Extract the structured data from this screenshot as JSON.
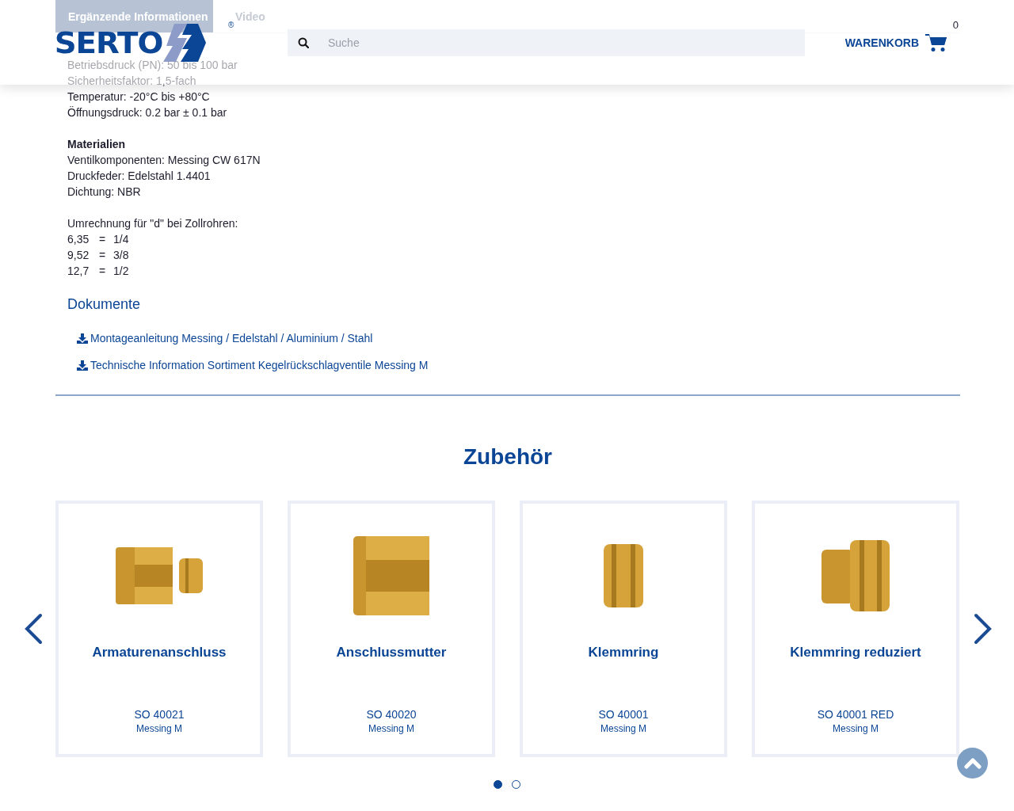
{
  "tabs": [
    {
      "label": "Ergänzende Informationen",
      "selected": true
    },
    {
      "label": "Video",
      "selected": false
    }
  ],
  "header": {
    "logo": "SERTO",
    "registered": "®",
    "search": {
      "placeholder": "Suche"
    },
    "cart": {
      "label": "WARENKORB",
      "count": "0"
    }
  },
  "specs": {
    "lines": [
      "Betriebsdruck (PN): 50 bis 100 bar",
      "Sicherheitsfaktor: 1,5-fach",
      "Temperatur: -20°C bis +80°C",
      "Öffnungsdruck: 0.2 bar ± 0.1 bar"
    ]
  },
  "materials": {
    "heading": "Materialien",
    "lines": [
      "Ventilkomponenten: Messing CW 617N",
      "Druckfeder: Edelstahl 1.4401",
      "Dichtung: NBR"
    ]
  },
  "conversion": {
    "heading": "Umrechnung für \"d\" bei Zollrohren:",
    "rows": [
      {
        "mm": "6,35",
        "eq": "=",
        "inch": "1/4"
      },
      {
        "mm": "9,52",
        "eq": "=",
        "inch": "3/8"
      },
      {
        "mm": "12,7",
        "eq": "=",
        "inch": "1/2"
      }
    ]
  },
  "documents": {
    "heading": "Dokumente",
    "links": [
      "Montageanleitung Messing / Edelstahl / Aluminium / Stahl",
      "Technische Information Sortiment Kegelrückschlagventile Messing M"
    ]
  },
  "accessories": {
    "heading": "Zubehör",
    "products": [
      {
        "name": "Armaturenanschluss",
        "code": "SO 40021",
        "material": "Messing M",
        "kind": "picture"
      },
      {
        "name": "Anschlussmutter",
        "code": "SO 40020",
        "material": "Messing M",
        "kind": "picture"
      },
      {
        "name": "Klemmring",
        "code": "SO 40001",
        "material": "Messing M",
        "kind": "picture"
      },
      {
        "name": "Klemmring reduziert",
        "code": "SO 40001 RED",
        "material": "Messing M",
        "kind": "picture"
      }
    ],
    "pages": [
      {
        "selected": true
      },
      {
        "selected": false
      }
    ]
  }
}
